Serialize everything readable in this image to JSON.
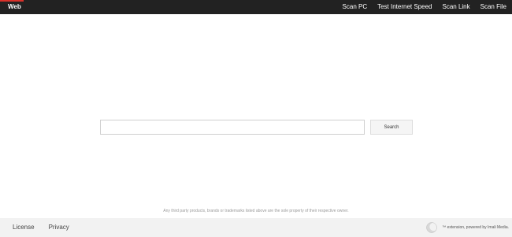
{
  "topbar": {
    "tab_label": "Web",
    "nav": [
      {
        "label": "Scan PC"
      },
      {
        "label": "Test Internet Speed"
      },
      {
        "label": "Scan Link"
      },
      {
        "label": "Scan File"
      }
    ]
  },
  "search": {
    "value": "",
    "button_label": "Search"
  },
  "disclaimer": "Any third party products, brands or trademarks listed above are the sole property of their respective owner.",
  "footer": {
    "links": [
      {
        "label": "License"
      },
      {
        "label": "Privacy"
      }
    ],
    "brand_text": "™ extension, powered by Imali Media."
  },
  "colors": {
    "topbar_bg": "#222222",
    "accent": "#d9312a",
    "footer_bg": "#f2f2f2"
  },
  "icons": {
    "brand_logo": "crescent-logo-icon"
  }
}
